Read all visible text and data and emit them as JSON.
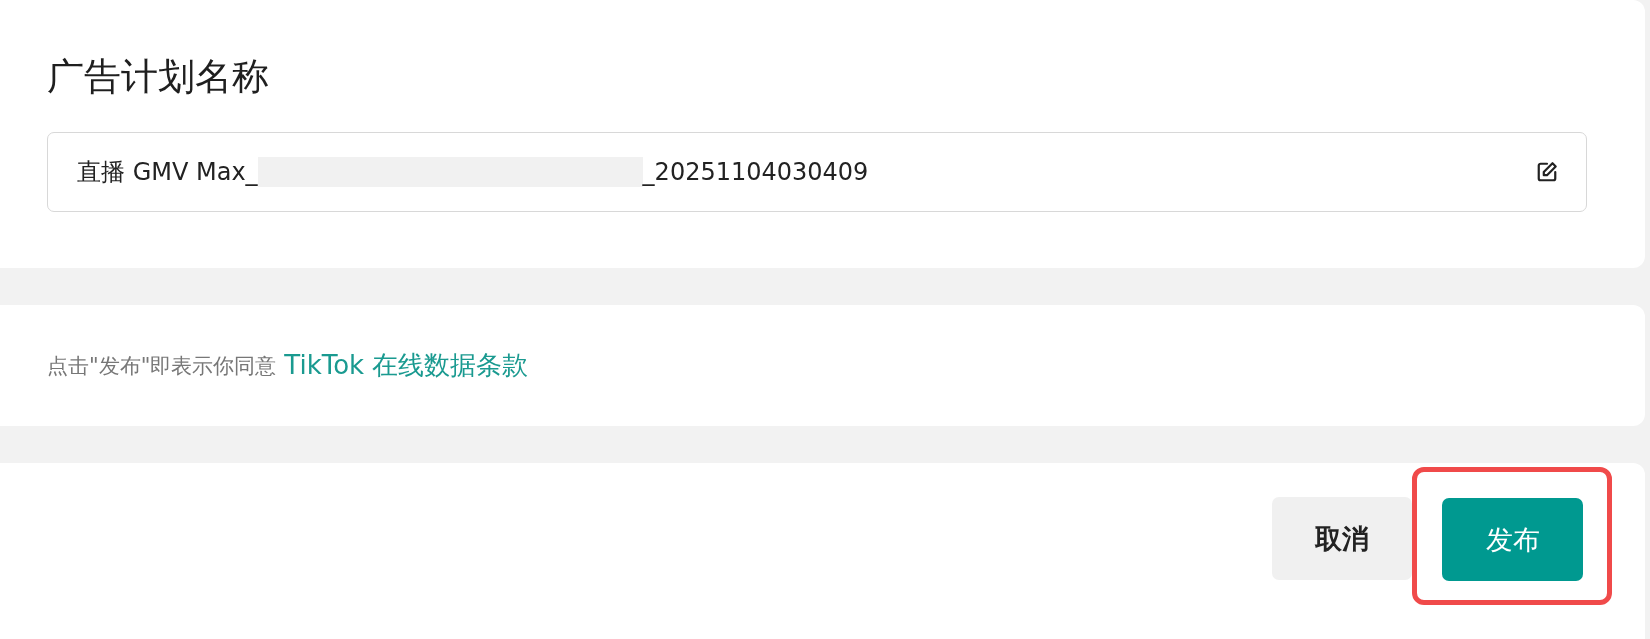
{
  "name_section": {
    "title": "广告计划名称",
    "field": {
      "value_start": "直播 GMV Max_",
      "redacted": true,
      "value_end": "_20251104030409"
    }
  },
  "agreement": {
    "text": "点击\"发布\"即表示你同意",
    "link": "TikTok 在线数据条款"
  },
  "actions": {
    "buttons": [
      {
        "kind": "secondary",
        "label": "取消",
        "highlighted": false
      },
      {
        "kind": "primary",
        "label": "发布",
        "highlighted": true
      }
    ]
  }
}
